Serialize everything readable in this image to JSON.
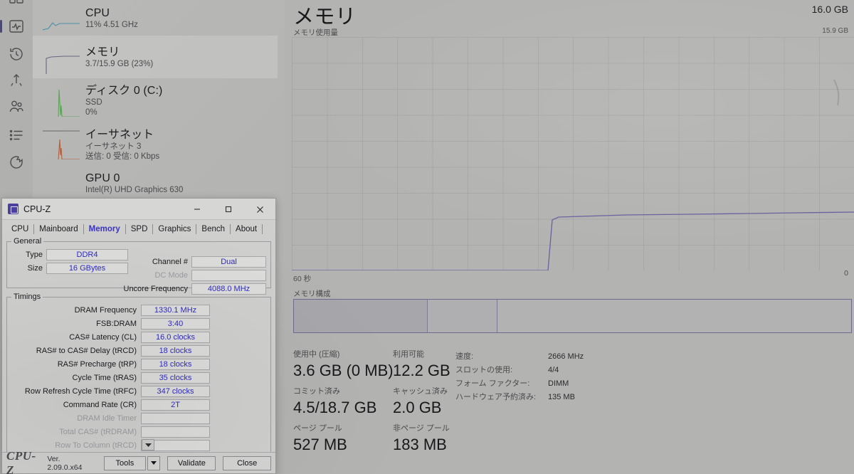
{
  "taskmanager": {
    "nav_icons": [
      {
        "name": "processes-icon"
      },
      {
        "name": "performance-icon"
      },
      {
        "name": "app-history-icon"
      },
      {
        "name": "startup-apps-icon"
      },
      {
        "name": "users-icon"
      },
      {
        "name": "details-icon"
      },
      {
        "name": "services-icon"
      }
    ],
    "resources": [
      {
        "name": "CPU",
        "detail": "11%  4.51 GHz",
        "detail2": "",
        "selected": false,
        "color": "#3f8fa8"
      },
      {
        "name": "メモリ",
        "detail": "3.7/15.9 GB (23%)",
        "detail2": "",
        "selected": true,
        "color": "#6b5aa8"
      },
      {
        "name": "ディスク 0 (C:)",
        "detail": "SSD",
        "detail2": "0%",
        "selected": false,
        "color": "#4f9a4f"
      },
      {
        "name": "イーサネット",
        "detail": "イーサネット 3",
        "detail2": "送信: 0  受信: 0 Kbps",
        "selected": false,
        "color": "#b05a3a"
      },
      {
        "name": "GPU 0",
        "detail": "Intel(R) UHD Graphics 630",
        "detail2": "",
        "selected": false,
        "color": "#6b5aa8"
      }
    ],
    "pane": {
      "title": "メモリ",
      "capacity": "16.0 GB",
      "graph_caption": "メモリ使用量",
      "graph_max_label": "15.9 GB",
      "axis_time": "60 秒",
      "axis_zero": "0",
      "composition_caption": "メモリ構成"
    },
    "stats": {
      "in_use_label": "使用中 (圧縮)",
      "in_use_value": "3.6 GB (0 MB)",
      "available_label": "利用可能",
      "available_value": "12.2 GB",
      "committed_label": "コミット済み",
      "committed_value": "4.5/18.7 GB",
      "cached_label": "キャッシュ済み",
      "cached_value": "2.0 GB",
      "paged_pool_label": "ページ プール",
      "paged_pool_value": "527 MB",
      "nonpaged_pool_label": "非ページ プール",
      "nonpaged_pool_value": "183 MB",
      "right": [
        {
          "key": "速度:",
          "value": "2666 MHz"
        },
        {
          "key": "スロットの使用:",
          "value": "4/4"
        },
        {
          "key": "フォーム ファクター:",
          "value": "DIMM"
        },
        {
          "key": "ハードウェア予約済み:",
          "value": "135 MB"
        }
      ]
    }
  },
  "chart_data": {
    "type": "line",
    "title": "メモリ使用量",
    "ylabel": "",
    "xlabel": "60 秒",
    "ylim": [
      0,
      15.9
    ],
    "y_max_label": "15.9 GB",
    "y_min_label": "0",
    "x_range_label": "60 秒",
    "unit": "GB",
    "grid": true,
    "legend": null,
    "line_color": "#6b5f9e",
    "x": [
      0,
      2,
      4,
      6,
      8,
      10,
      12,
      14,
      16,
      18,
      20,
      22,
      24,
      26,
      28,
      30,
      32,
      34,
      36,
      38,
      40,
      42,
      44,
      46,
      48,
      50,
      52,
      54,
      56,
      58,
      60
    ],
    "values": [
      0,
      0,
      0,
      0,
      0,
      0,
      0,
      0,
      0,
      0,
      0,
      0,
      0,
      0,
      0,
      0,
      0,
      0,
      3.35,
      3.62,
      3.64,
      3.64,
      3.64,
      3.65,
      3.7,
      3.71,
      3.71,
      3.71,
      3.72,
      3.72,
      3.73
    ],
    "annotation": "Memory usage jumps from 0 to ~3.6 GB (23%) and plateaus"
  },
  "composition": {
    "segments": [
      {
        "name": "in-use",
        "width_pct": 24.0
      },
      {
        "name": "modified",
        "width_pct": 12.5
      },
      {
        "name": "standby-free",
        "width_pct": 63.5
      }
    ]
  },
  "cpuz": {
    "window_title": "CPU-Z",
    "window_buttons": {
      "minimize": "minimize-icon",
      "maximize": "maximize-icon",
      "close": "close-icon"
    },
    "tabs": [
      {
        "label": "CPU",
        "active": false
      },
      {
        "label": "Mainboard",
        "active": false
      },
      {
        "label": "Memory",
        "active": true
      },
      {
        "label": "SPD",
        "active": false
      },
      {
        "label": "Graphics",
        "active": false
      },
      {
        "label": "Bench",
        "active": false
      },
      {
        "label": "About",
        "active": false
      }
    ],
    "general": {
      "legend": "General",
      "left": [
        {
          "label": "Type",
          "value": "DDR4",
          "dim": false
        },
        {
          "label": "Size",
          "value": "16 GBytes",
          "dim": false
        }
      ],
      "right": [
        {
          "label": "Channel #",
          "value": "Dual",
          "dim": false
        },
        {
          "label": "DC Mode",
          "value": "",
          "dim": true
        },
        {
          "label": "Uncore Frequency",
          "value": "4088.0 MHz",
          "dim": false
        }
      ]
    },
    "timings": {
      "legend": "Timings",
      "rows": [
        {
          "label": "DRAM Frequency",
          "value": "1330.1 MHz",
          "dim": false
        },
        {
          "label": "FSB:DRAM",
          "value": "3:40",
          "dim": false
        },
        {
          "label": "CAS# Latency (CL)",
          "value": "16.0 clocks",
          "dim": false
        },
        {
          "label": "RAS# to CAS# Delay (tRCD)",
          "value": "18 clocks",
          "dim": false
        },
        {
          "label": "RAS# Precharge (tRP)",
          "value": "18 clocks",
          "dim": false
        },
        {
          "label": "Cycle Time (tRAS)",
          "value": "35 clocks",
          "dim": false
        },
        {
          "label": "Row Refresh Cycle Time (tRFC)",
          "value": "347 clocks",
          "dim": false
        },
        {
          "label": "Command Rate (CR)",
          "value": "2T",
          "dim": false
        },
        {
          "label": "DRAM Idle Timer",
          "value": "",
          "dim": true
        },
        {
          "label": "Total CAS# (tRDRAM)",
          "value": "",
          "dim": true
        },
        {
          "label": "Row To Column (tRCD)",
          "value": "",
          "dim": true
        }
      ]
    },
    "footer": {
      "brand": "CPU-Z",
      "version": "Ver. 2.09.0.x64",
      "tools_label": "Tools",
      "dropdown_icon": "chevron-down-icon",
      "validate_label": "Validate",
      "close_label": "Close"
    }
  }
}
